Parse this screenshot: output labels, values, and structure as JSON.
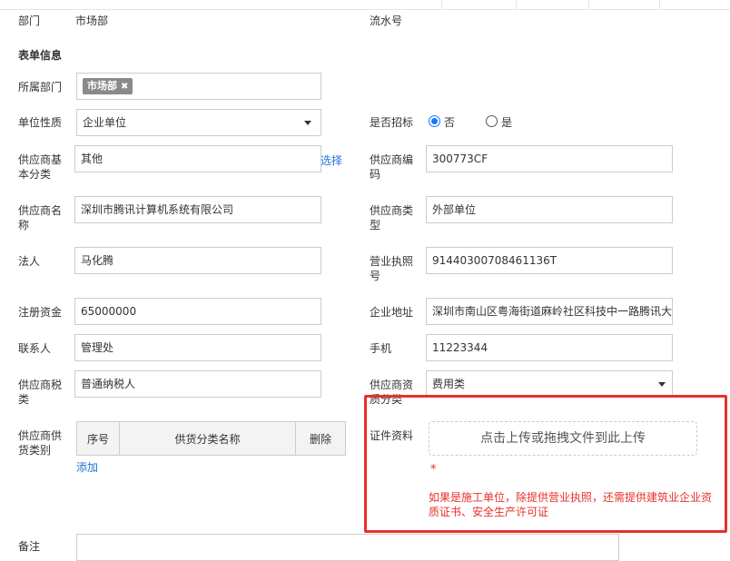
{
  "header_row": {
    "dept_label": "部门",
    "dept_value": "市场部",
    "serial_label": "流水号"
  },
  "section_title": "表单信息",
  "form": {
    "belong_dept_label": "所属部门",
    "belong_dept_tag": "市场部",
    "unit_type_label": "单位性质",
    "unit_type_value": "企业单位",
    "bidding_label": "是否招标",
    "bidding_options": [
      "否",
      "是"
    ],
    "bidding_selected": "否",
    "supplier_basic_cat_label": "供应商基本分类",
    "supplier_basic_cat_value": "其他",
    "select_link": "选择",
    "supplier_code_label": "供应商编码",
    "supplier_code_value": "300773CF",
    "supplier_name_label": "供应商名称",
    "supplier_name_value": "深圳市腾讯计算机系统有限公司",
    "supplier_type_label": "供应商类型",
    "supplier_type_value": "外部单位",
    "legal_person_label": "法人",
    "legal_person_value": "马化腾",
    "license_label": "营业执照号",
    "license_value": "91440300708461136T",
    "capital_label": "注册资金",
    "capital_value": "65000000",
    "address_label": "企业地址",
    "address_value": "深圳市南山区粤海街道麻岭社区科技中一路腾讯大厦",
    "contact_label": "联系人",
    "contact_value": "管理处",
    "phone_label": "手机",
    "phone_value": "11223344",
    "tax_label": "供应商税类",
    "tax_value": "普通纳税人",
    "qual_label": "供应商资质分类",
    "qual_value": "费用类",
    "supply_cat_label": "供应商供货类别",
    "supply_table_headers": [
      "序号",
      "供货分类名称",
      "删除"
    ],
    "add_link": "添加",
    "cert_label": "证件资料",
    "upload_text": "点击上传或拖拽文件到此上传",
    "required_mark": "*",
    "cert_hint": "如果是施工单位，除提供营业执照，还需提供建筑业企业资质证书、安全生产许可证",
    "notes_label": "备注"
  },
  "colors": {
    "accent_blue": "#1677ff",
    "link_blue": "#1f74d6",
    "alert_red": "#e8302a",
    "tag_gray": "#8a8a8a",
    "border_gray": "#cccccc"
  }
}
